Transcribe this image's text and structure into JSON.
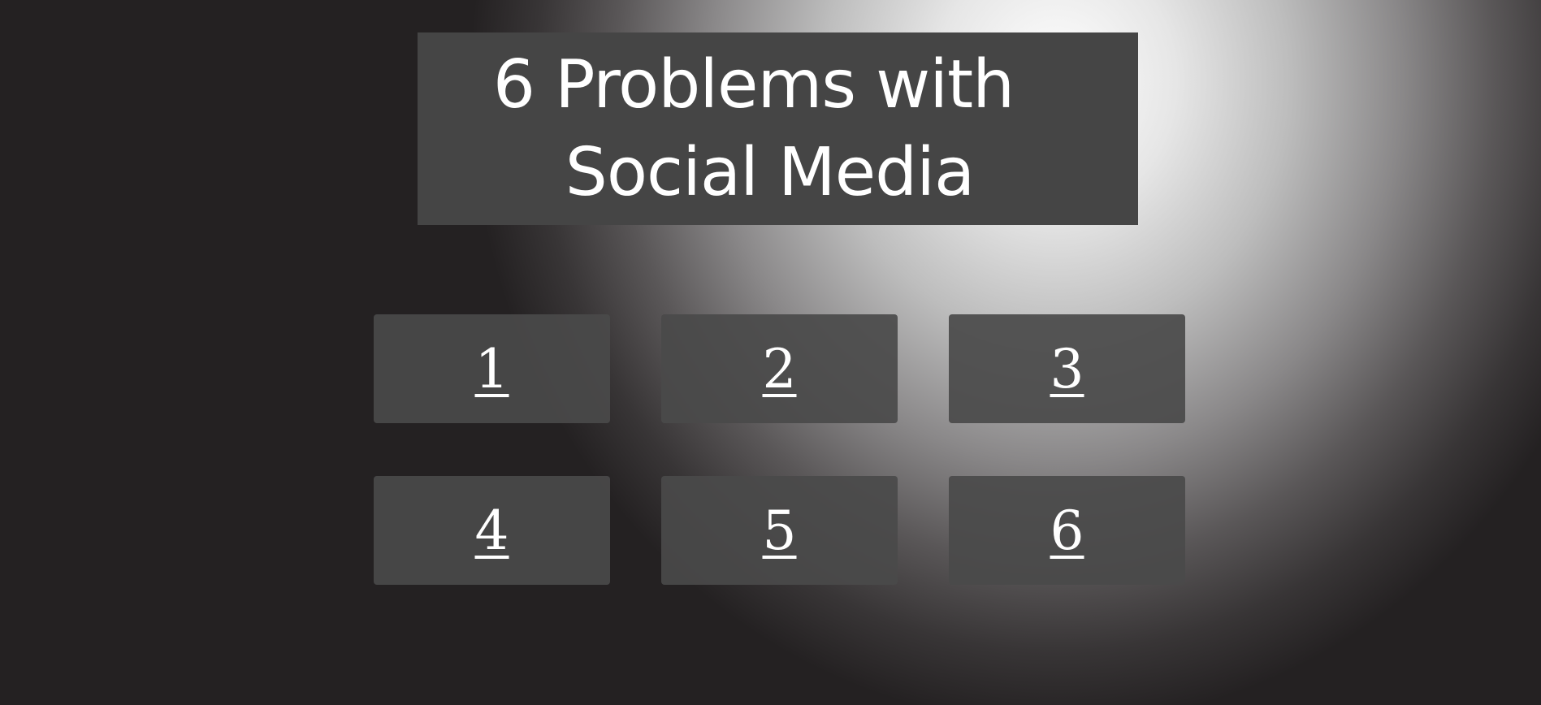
{
  "title": {
    "line1": "6 Problems with",
    "line2": "Social Media"
  },
  "tiles": [
    {
      "label": "1"
    },
    {
      "label": "2"
    },
    {
      "label": "3"
    },
    {
      "label": "4"
    },
    {
      "label": "5"
    },
    {
      "label": "6"
    }
  ],
  "colors": {
    "background": "#242122",
    "spotlight": "#ffffff",
    "panel": "#454545",
    "text": "#ffffff"
  }
}
